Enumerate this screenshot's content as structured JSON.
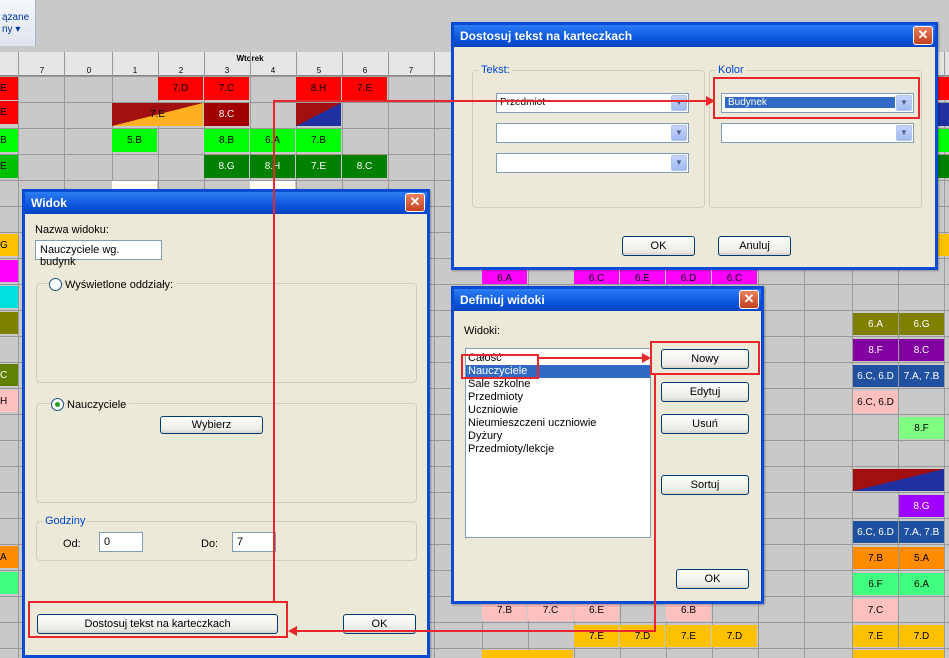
{
  "toolbar": {
    "label_line1": "ązane",
    "label_line2": "ny ▾"
  },
  "grid": {
    "day_label": "Wtorek",
    "left_periods": [
      "7"
    ],
    "periods": [
      "0",
      "1",
      "2",
      "3",
      "4",
      "5",
      "6",
      "7"
    ]
  },
  "cells": [
    "7.D",
    "7.C",
    "8.H",
    "7.E",
    "7.E",
    "8.C",
    "5.B",
    "8.B",
    "6.A",
    "7.B",
    "8.G",
    "8.H",
    "7.E",
    "8.C",
    "6.A",
    "6.C",
    "6.E",
    "6.D",
    "6.C",
    "6.A",
    "6.G",
    "8.F",
    "8.C",
    "6.C, 6.D",
    "7.A, 7.B",
    "6.C, 6.D",
    "8.F",
    "8.G",
    "6.C, 6.D",
    "7.A, 7.B",
    "7.B",
    "5.A",
    "6.F",
    "6.A",
    "7.B",
    "7.C",
    "6.E",
    "6.B",
    "7.C",
    "7.E",
    "7.D",
    "7.E",
    "7.D",
    "7.E",
    "7.D",
    "E",
    "E",
    "B",
    "E",
    "G",
    "A",
    "D",
    "C",
    "H",
    "A"
  ],
  "dostosuj": {
    "title": "Dostosuj tekst na karteczkach",
    "tekst_label": "Tekst:",
    "kolor_label": "Kolor",
    "combo1": "Przedmiot",
    "combo2": "",
    "combo3": "",
    "kolor_combo1": "Budynek",
    "kolor_combo2": "",
    "ok": "OK",
    "cancel": "Anuluj",
    "close": "✕"
  },
  "widok": {
    "title": "Widok",
    "name_label": "Nazwa widoku:",
    "name_value": "Nauczyciele wg. budynk",
    "radio1": "Wyświetlone oddziały:",
    "radio2": "Nauczyciele",
    "wybierz": "Wybierz",
    "godziny": "Godziny",
    "od_label": "Od:",
    "od_value": "0",
    "do_label": "Do:",
    "do_value": "7",
    "dostosuj_btn": "Dostosuj tekst na karteczkach",
    "ok": "OK",
    "close": "✕"
  },
  "definiuj": {
    "title": "Definiuj widoki",
    "widoki_label": "Widoki:",
    "items": [
      "Całość",
      "Nauczyciele",
      "Sale szkolne",
      "Przedmioty",
      "Uczniowie",
      "Nieumieszczeni uczniowie",
      "Dyżury",
      "Przedmioty/lekcje"
    ],
    "nowy": "Nowy",
    "edytuj": "Edytuj",
    "usun": "Usuń",
    "sortuj": "Sortuj",
    "ok": "OK",
    "close": "✕"
  },
  "colors": {
    "red": "#ff0000",
    "green": "#00ff00",
    "darkgreen": "#008000",
    "orange": "#ff8c00",
    "yellow": "#ffc000",
    "pink": "#ffc0c0",
    "magenta": "#ff00ff",
    "purple": "#8000c0",
    "olive": "#808000",
    "blue": "#2040a0",
    "title_blue": "#0a4bd4"
  }
}
